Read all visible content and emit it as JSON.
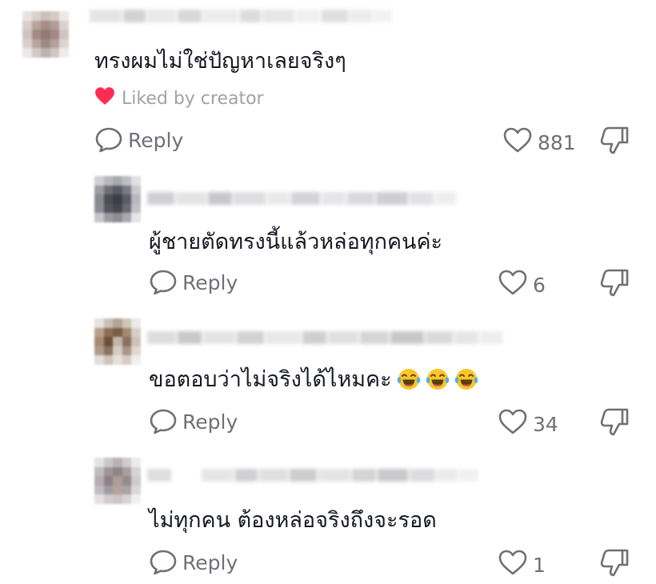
{
  "colors": {
    "text": "#161823",
    "muted": "#6f7077",
    "liked_heart": "#fe2c55"
  },
  "comments": [
    {
      "text": "ทรงผมไม่ใช่ปัญหาเลยจริงๆ",
      "liked_by_creator": "Liked by creator",
      "reply_label": "Reply",
      "like_count": "881"
    },
    {
      "text": "ผู้ชายตัดทรงนี้แล้วหล่อทุกคนค่ะ",
      "reply_label": "Reply",
      "like_count": "6"
    },
    {
      "text": "ขอตอบว่าไม่จริงได้ไหมคะ",
      "emojis": [
        "face-with-tears-of-joy",
        "face-with-tears-of-joy",
        "face-with-tears-of-joy"
      ],
      "reply_label": "Reply",
      "like_count": "34"
    },
    {
      "text": "ไม่ทุกคน ต้องหล่อจริงถึงจะรอด",
      "reply_label": "Reply",
      "like_count": "1"
    }
  ],
  "icons": {
    "reply": "speech-bubble-icon",
    "like": "heart-outline-icon",
    "dislike": "thumbs-down-icon",
    "liked_by_creator": "heart-filled-icon"
  }
}
